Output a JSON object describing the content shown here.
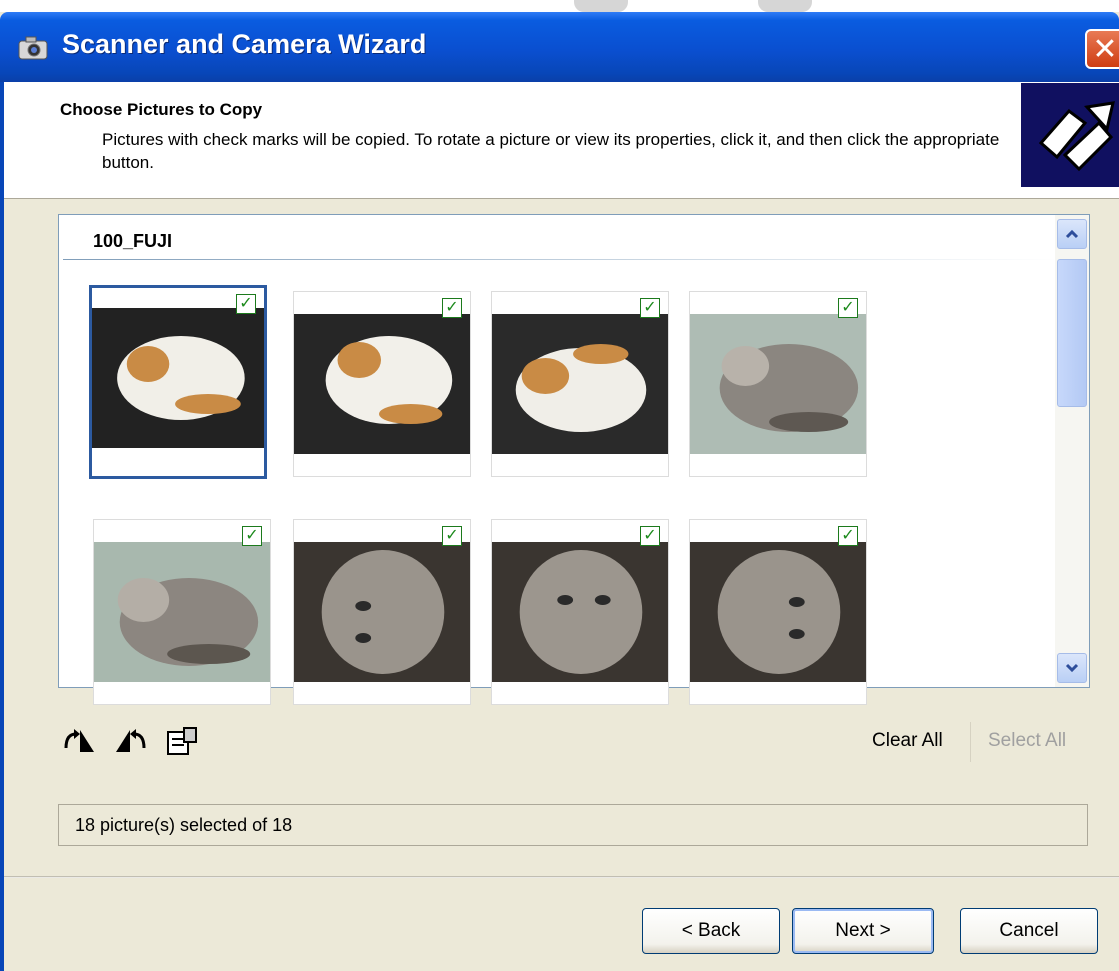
{
  "window": {
    "title": "Scanner and Camera Wizard",
    "close_glyph": "✕"
  },
  "header": {
    "title": "Choose Pictures to Copy",
    "subtitle": "Pictures with check marks will be copied. To rotate a picture or view its properties, click it, and then click the appropriate button."
  },
  "folder": {
    "name": "100_FUJI"
  },
  "thumbnails": [
    {
      "checked": "✓",
      "subject": "orange-white cat curled",
      "selected": true
    },
    {
      "checked": "✓",
      "subject": "orange-white cat curled"
    },
    {
      "checked": "✓",
      "subject": "orange-white cat curled"
    },
    {
      "checked": "✓",
      "subject": "grey tabby cat curled"
    },
    {
      "checked": "✓",
      "subject": "grey tabby cat lying"
    },
    {
      "checked": "✓",
      "subject": "grey cat face close-up"
    },
    {
      "checked": "✓",
      "subject": "grey cat face close-up"
    },
    {
      "checked": "✓",
      "subject": "grey cat face close-up"
    }
  ],
  "toolbar": {
    "icons": [
      "rotate-clockwise-icon",
      "rotate-counterclockwise-icon",
      "properties-icon"
    ],
    "clear_all": "Clear All",
    "select_all": "Select All"
  },
  "status": {
    "text": "18 picture(s) selected of 18"
  },
  "buttons": {
    "back": "< Back",
    "next": "Next >",
    "cancel": "Cancel"
  },
  "colors": {
    "titlebar": "#0a4fd0",
    "selection": "#2c5aa0",
    "check": "#1c8a1c",
    "face": "#ece9d8"
  }
}
